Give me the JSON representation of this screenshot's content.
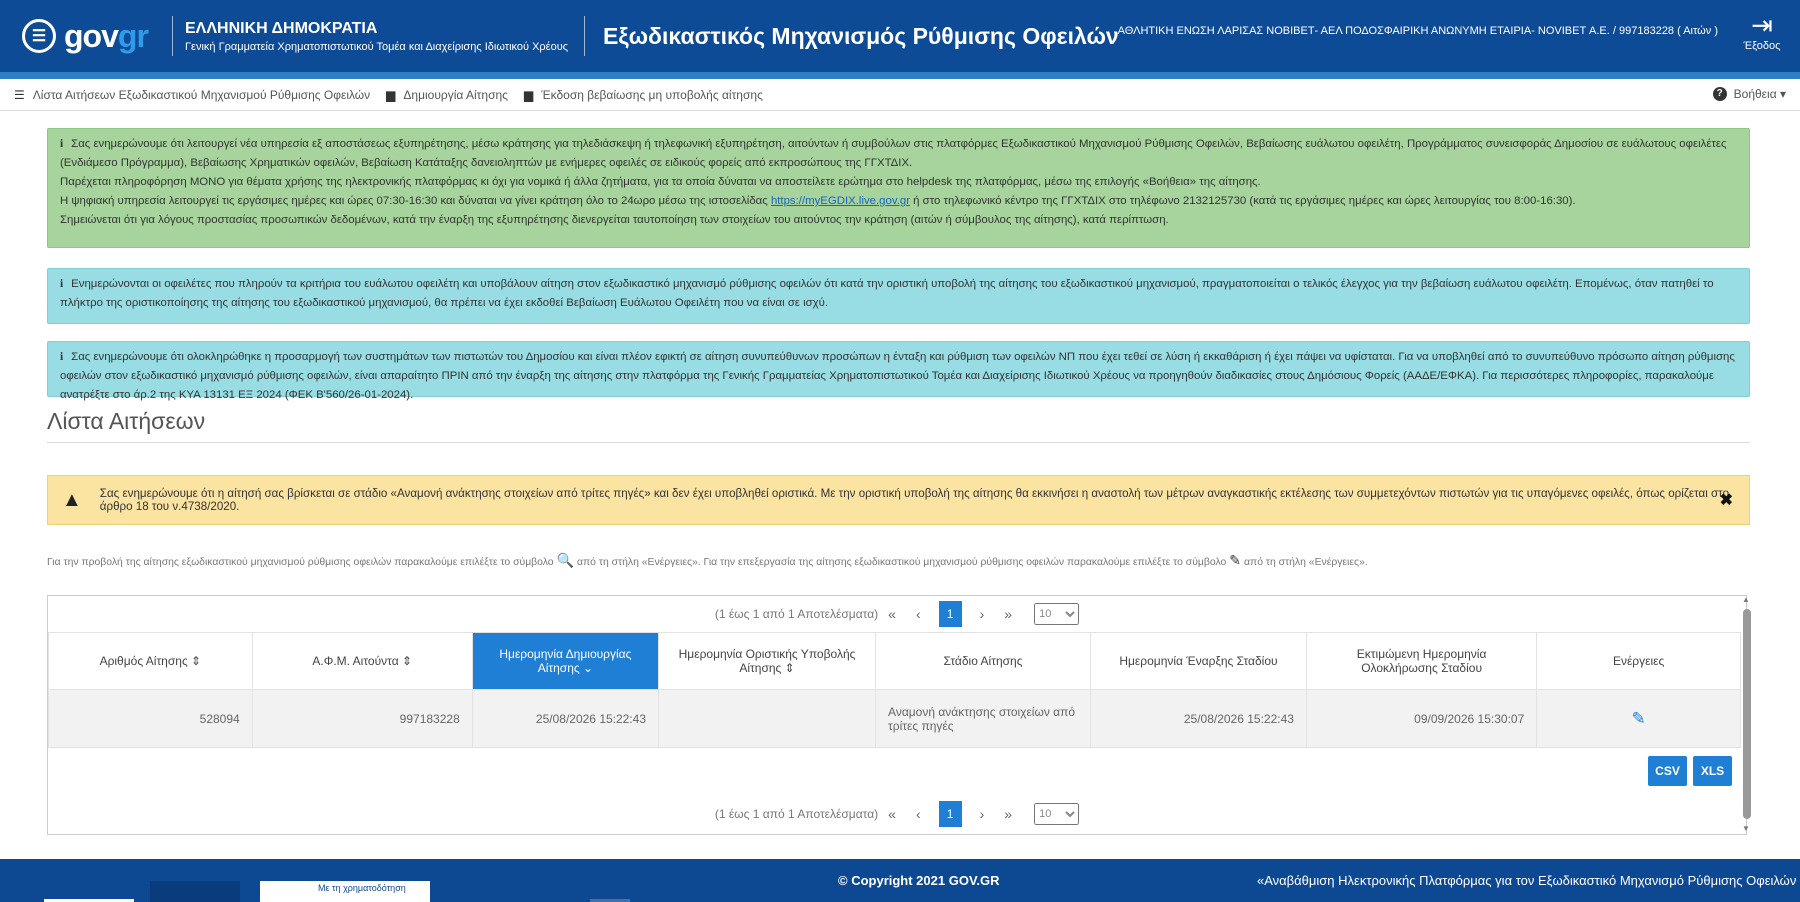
{
  "header": {
    "logo_text_a": "gov",
    "logo_text_b": "gr",
    "gov_title": "ΕΛΛΗΝΙΚΗ ΔΗΜΟΚΡΑΤΙΑ",
    "gov_subtitle": "Γενική Γραμματεία Χρηματοπιστωτικού Τομέα και Διαχείρισης Ιδιωτικού Χρέους",
    "app_title": "Εξωδικαστικός Μηχανισμός Ρύθμισης Οφειλών",
    "user_label": "ΑΘΛΗΤΙΚΗ ΕΝΩΣΗ ΛΑΡΙΣΑΣ ΝΟΒΙΒΕΤ- ΑΕΛ ΠΟΔΟΣΦΑΙΡΙΚΗ ΑΝΩΝΥΜΗ ΕΤΑΙΡΙΑ- NOVIBET Α.Ε. / 997183228 ( Αιτών )",
    "logout_label": "Έξοδος"
  },
  "nav": {
    "items": [
      {
        "label": "Λίστα Αιτήσεων Εξωδικαστικού Μηχανισμού Ρύθμισης Οφειλών",
        "icon": "list-icon"
      },
      {
        "label": "Δημιουργία Αίτησης",
        "icon": "document-icon"
      },
      {
        "label": "Έκδοση βεβαίωσης μη υποβολής αίτησης",
        "icon": "document-icon"
      }
    ],
    "help_label": "Βοήθεια"
  },
  "alerts": {
    "green": {
      "p1": "Σας ενημερώνουμε ότι λειτουργεί νέα υπηρεσία εξ αποστάσεως εξυπηρέτησης, μέσω κράτησης για τηλεδιάσκεψη ή τηλεφωνική εξυπηρέτηση, αιτούντων ή συμβούλων στις πλατφόρμες Εξωδικαστικού Μηχανισμού Ρύθμισης Οφειλών, Βεβαίωσης ευάλωτου οφειλέτη, Προγράμματος συνεισφοράς Δημοσίου σε ευάλωτους οφειλέτες (Ενδιάμεσο Πρόγραμμα), Βεβαίωσης Χρηματικών οφειλών, Βεβαίωση Κατάταξης δανειοληπτών με ενήμερες οφειλές σε ειδικούς φορείς από εκπροσώπους της ΓΓΧΤΔΙΧ.",
      "p2": "Παρέχεται πληροφόρηση ΜΟΝΟ για θέματα χρήσης της ηλεκτρονικής πλατφόρμας κι όχι για νομικά ή άλλα ζητήματα, για τα οποία δύναται να αποστείλετε ερώτημα στο helpdesk της πλατφόρμας, μέσω της επιλογής «Βοήθεια» της αίτησης.",
      "p3a": "Η ψηφιακή υπηρεσία λειτουργεί τις εργάσιμες ημέρες και ώρες 07:30-16:30 και δύναται να γίνει κράτηση όλο το 24ωρο μέσω της ιστοσελίδας",
      "p3_link": "https://myEGDIX.live.gov.gr",
      "p3b": "ή στο τηλεφωνικό κέντρο της ΓΓΧΤΔΙΧ στο τηλέφωνο 2132125730 (κατά τις εργάσιμες ημέρες και ώρες λειτουργίας του 8:00-16:30).",
      "p4": "Σημειώνεται ότι για λόγους προστασίας προσωπικών δεδομένων, κατά την έναρξη της εξυπηρέτησης διενεργείται ταυτοποίηση των στοιχείων του αιτούντος την κράτηση (αιτών ή σύμβουλος της αίτησης), κατά περίπτωση."
    },
    "blue1": "Ενημερώνονται οι οφειλέτες που πληρούν τα κριτήρια του ευάλωτου οφειλέτη και υποβάλουν αίτηση στον εξωδικαστικό μηχανισμό ρύθμισης οφειλών ότι κατά την οριστική υποβολή της αίτησης του εξωδικαστικού μηχανισμού, πραγματοποιείται ο τελικός έλεγχος για την βεβαίωση ευάλωτου οφειλέτη. Επομένως, όταν πατηθεί το πλήκτρο της οριστικοποίησης της αίτησης του εξωδικαστικού μηχανισμού, θα πρέπει να έχει εκδοθεί Βεβαίωση Ευάλωτου Οφειλέτη που να είναι σε ισχύ.",
    "blue2": "Σας ενημερώνουμε ότι ολοκληρώθηκε η προσαρμογή των συστημάτων των πιστωτών του Δημοσίου και είναι πλέον εφικτή σε αίτηση συνυπεύθυνων προσώπων η ένταξη και ρύθμιση των οφειλών ΝΠ που έχει τεθεί σε λύση ή εκκαθάριση ή έχει πάψει να υφίσταται. Για να υποβληθεί από το συνυπεύθυνο πρόσωπο αίτηση ρύθμισης οφειλών στον εξωδικαστικό μηχανισμό ρύθμισης οφειλών, είναι απαραίτητο ΠΡΙΝ από την έναρξη της αίτησης στην πλατφόρμα της Γενικής Γραμματείας Χρηματοπιστωτικού Τομέα και Διαχείρισης Ιδιωτικού Χρέους να προηγηθούν διαδικασίες στους Δημόσιους Φορείς (ΑΑΔΕ/ΕΦΚΑ). Για περισσότερες πληροφορίες, παρακαλούμε ανατρέξτε στο άρ.2 της ΚΥΑ 13131 ΕΞ 2024 (ΦΕΚ Β'560/26-01-2024).",
    "warning": "Σας ενημερώνουμε ότι η αίτησή σας βρίσκεται σε στάδιο «Αναμονή ανάκτησης στοιχείων από τρίτες πηγές» και δεν έχει υποβληθεί οριστικά. Με την οριστική υποβολή της αίτησης θα εκκινήσει η αναστολή των μέτρων αναγκαστικής εκτέλεσης των συμμετεχόντων πιστωτών για τις υπαγόμενες οφειλές, όπως ορίζεται στο άρθρο 18 του ν.4738/2020."
  },
  "section": {
    "title": "Λίστα Αιτήσεων",
    "instr_a": "Για την προβολή της αίτησης εξωδικαστικού μηχανισμού ρύθμισης οφειλών παρακαλούμε επιλέξτε το σύμβολο",
    "instr_b": "από τη στήλη «Ενέργειες». Για την επεξεργασία της αίτησης εξωδικαστικού μηχανισμού ρύθμισης οφειλών παρακαλούμε επιλέξτε το σύμβολο",
    "instr_c": "από τη στήλη «Ενέργειες»."
  },
  "pager": {
    "summary": "(1 έως 1 από 1 Αποτελέσματα)",
    "first": "«",
    "prev": "‹",
    "current": "1",
    "next": "›",
    "last": "»",
    "page_size": "10"
  },
  "table": {
    "headers": [
      "Αριθμός Αίτησης ⇕",
      "Α.Φ.Μ. Αιτούντα ⇕",
      "Ημερομηνία Δημιουργίας Αίτησης ⌄",
      "Ημερομηνία Οριστικής Υποβολής Αίτησης ⇕",
      "Στάδιο Αίτησης",
      "Ημερομηνία Έναρξης Σταδίου",
      "Εκτιμώμενη Ημερομηνία Ολοκλήρωσης Σταδίου",
      "Ενέργειες"
    ],
    "rows": [
      {
        "app_no": "528094",
        "afm": "997183228",
        "created": "25/08/2026 15:22:43",
        "submitted": "",
        "stage": "Αναμονή ανάκτησης στοιχείων από τρίτες πηγές",
        "stage_start": "25/08/2026 15:22:43",
        "stage_end": "09/09/2026 15:30:07"
      }
    ],
    "csv_label": "CSV",
    "xls_label": "XLS"
  },
  "footer": {
    "copyright": "© Copyright 2021 GOV.GR",
    "right_text": "«Αναβάθμιση Ηλεκτρονικής Πλατφόρμας για τον Εξωδικαστικό Μηχανισμό Ρύθμισης Οφειλών για φυσικά",
    "logo_strip": "Με τη χρηματοδότηση"
  },
  "colors": {
    "header_bg": "#0e4b97",
    "accent": "#1e7fd4",
    "green_alert": "#a6d49c",
    "blue_alert": "#98dde3",
    "warning": "#fbe3a1"
  }
}
